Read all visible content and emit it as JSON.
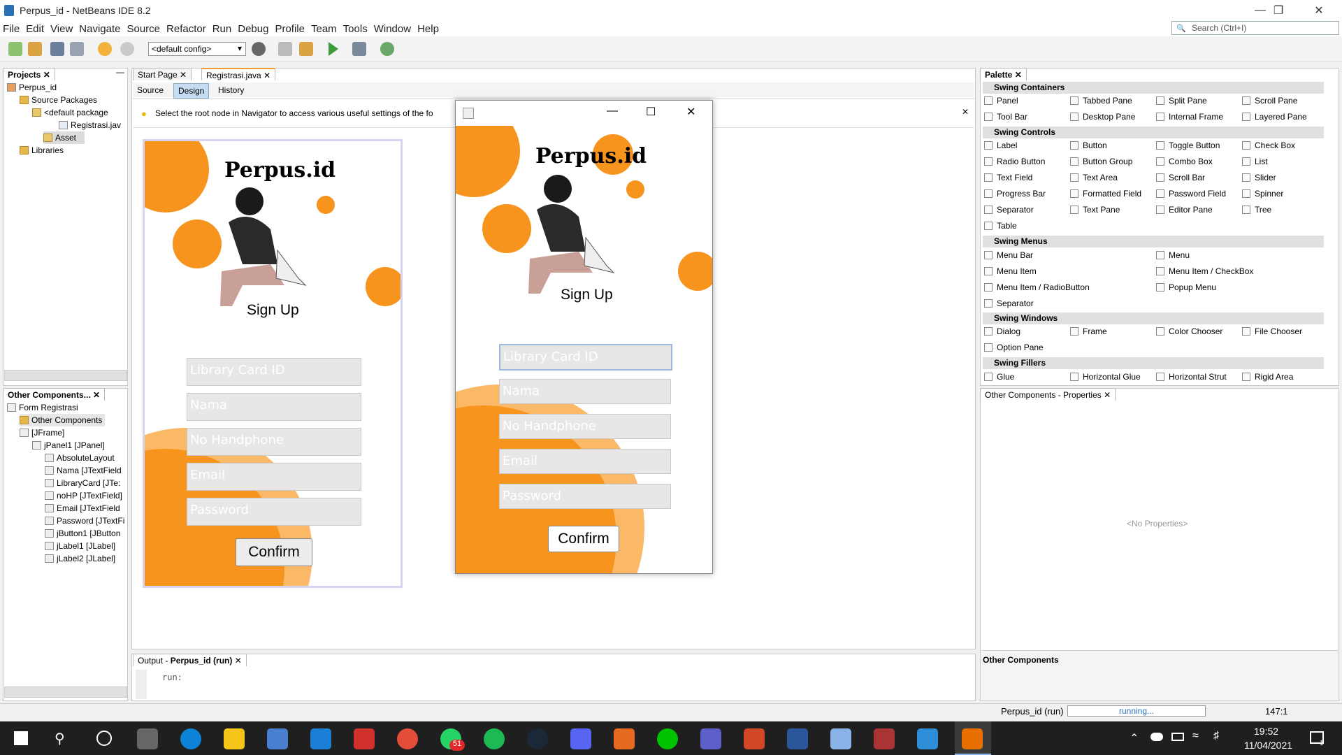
{
  "window": {
    "title": "Perpus_id - NetBeans IDE 8.2"
  },
  "menu": [
    "File",
    "Edit",
    "View",
    "Navigate",
    "Source",
    "Refactor",
    "Run",
    "Debug",
    "Profile",
    "Team",
    "Tools",
    "Window",
    "Help"
  ],
  "search": {
    "placeholder": "Search (Ctrl+I)"
  },
  "toolbar": {
    "config": "<default config>"
  },
  "projects": {
    "tab": "Projects",
    "tree": [
      "Perpus_id",
      "Source Packages",
      "<default package",
      "Registrasi.jav",
      "Asset",
      "Libraries"
    ]
  },
  "navigator": {
    "tab": "Other Components...",
    "tree": [
      "Form Registrasi",
      "Other Components",
      "[JFrame]",
      "jPanel1 [JPanel]",
      "AbsoluteLayout",
      "Nama [JTextField",
      "LibraryCard [JTe:",
      "noHP [JTextField]",
      "Email [JTextField",
      "Password [JTextFi",
      "jButton1 [JButton",
      "jLabel1 [JLabel]",
      "jLabel2 [JLabel]"
    ]
  },
  "editor": {
    "tabs": [
      "Start Page",
      "Registrasi.java"
    ],
    "modes": [
      "Source",
      "Design",
      "History"
    ],
    "hint": "Select the root node in Navigator to access various useful settings of the fo"
  },
  "form": {
    "brand": "Perpus.id",
    "title": "Sign Up",
    "fields": [
      "Library Card ID",
      "Nama",
      "No Handphone",
      "Email",
      "Password"
    ],
    "button": "Confirm"
  },
  "palette": {
    "tab": "Palette",
    "sections": [
      {
        "name": "Swing Containers",
        "items": [
          "Panel",
          "Tabbed Pane",
          "Split Pane",
          "Scroll Pane",
          "Tool Bar",
          "Desktop Pane",
          "Internal Frame",
          "Layered Pane"
        ]
      },
      {
        "name": "Swing Controls",
        "items": [
          "Label",
          "Button",
          "Toggle Button",
          "Check Box",
          "Radio Button",
          "Button Group",
          "Combo Box",
          "List",
          "Text Field",
          "Text Area",
          "Scroll Bar",
          "Slider",
          "Progress Bar",
          "Formatted Field",
          "Password Field",
          "Spinner",
          "Separator",
          "Text Pane",
          "Editor Pane",
          "Tree",
          "Table"
        ]
      },
      {
        "name": "Swing Menus",
        "items": [
          "Menu Bar",
          "Menu",
          "Menu Item",
          "Menu Item / CheckBox",
          "Menu Item / RadioButton",
          "Popup Menu",
          "Separator"
        ]
      },
      {
        "name": "Swing Windows",
        "items": [
          "Dialog",
          "Frame",
          "Color Chooser",
          "File Chooser",
          "Option Pane"
        ]
      },
      {
        "name": "Swing Fillers",
        "items": [
          "Glue",
          "Horizontal Glue",
          "Horizontal Strut",
          "Rigid Area"
        ]
      }
    ]
  },
  "properties": {
    "tab": "Other Components - Properties",
    "empty": "<No Properties>",
    "footer": "Other Components"
  },
  "output": {
    "tab_prefix": "Output - ",
    "tab_project": "Perpus_id (run)",
    "text": "run:"
  },
  "status": {
    "project": "Perpus_id (run)",
    "progress_label": "running...",
    "position": "147:1"
  },
  "taskbar": {
    "time": "19:52",
    "date": "11/04/2021",
    "badge": "51",
    "notif": "1"
  },
  "colors": {
    "accent_orange": "#f7941d",
    "light_orange": "#fbb866"
  }
}
